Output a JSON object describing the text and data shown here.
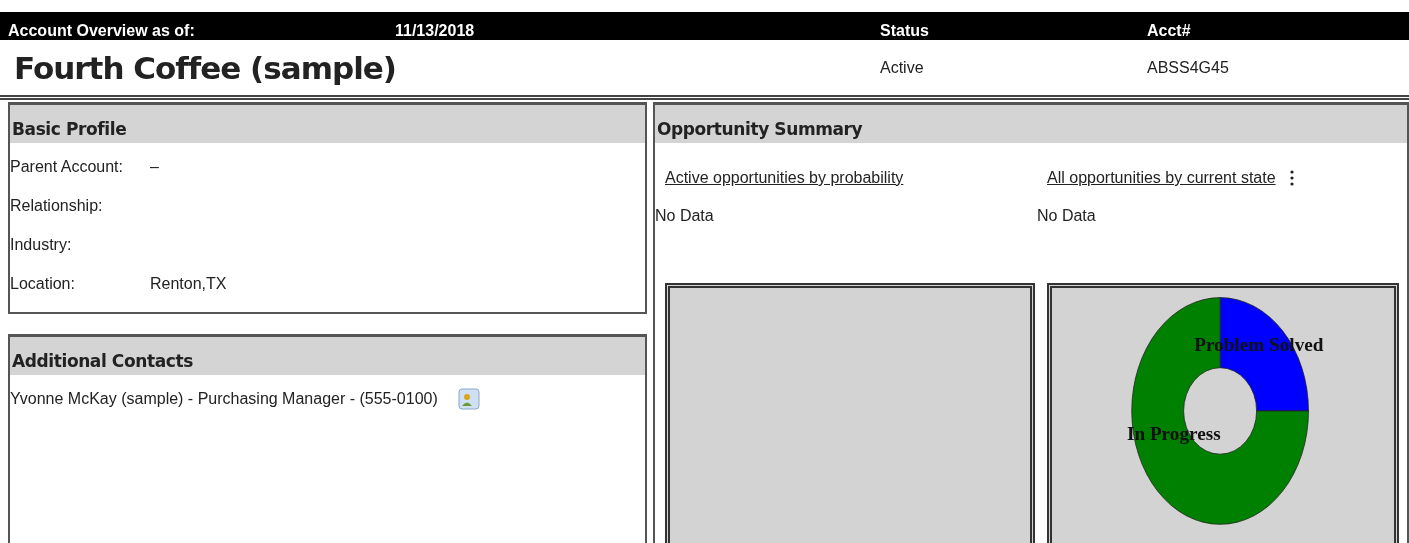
{
  "header": {
    "columns": [
      "Account Overview as of:",
      "11/13/2018",
      "Status",
      "Acct#"
    ]
  },
  "account": {
    "name": "Fourth Coffee (sample)",
    "status": "Active",
    "acct_number": "ABSS4G45"
  },
  "basic_profile": {
    "title": "Basic Profile",
    "fields": [
      {
        "label": "Parent Account:",
        "value": "–"
      },
      {
        "label": "Relationship:"
      },
      {
        "label": "Industry:"
      },
      {
        "label": "Location:",
        "value": "Renton,TX"
      }
    ]
  },
  "additional_contacts": {
    "title": "Additional Contacts",
    "contacts": [
      {
        "text": "Yvonne McKay (sample) - Purchasing Manager - (555-0100)"
      }
    ]
  },
  "opportunity_summary": {
    "title": "Opportunity Summary",
    "charts": [
      {
        "link": "Active opportunities by probability",
        "message": "No Data",
        "kind": "empty",
        "has_menu": false
      },
      {
        "link": "All opportunities by current state",
        "message": "No Data",
        "kind": "donut",
        "has_menu": true,
        "slices": [
          {
            "label": "Problem Solved",
            "color": "#0000ff"
          },
          {
            "label": "In Progress",
            "color": "#008000"
          }
        ]
      }
    ]
  }
}
